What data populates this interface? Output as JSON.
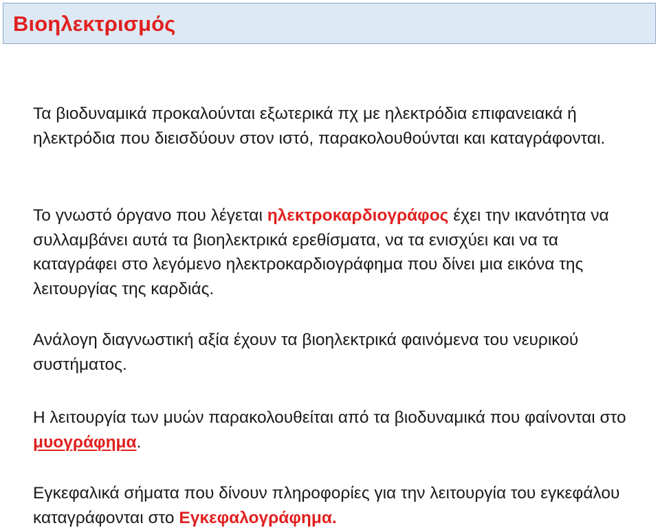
{
  "title": "Βιοηλεκτρισμός",
  "paragraphs": {
    "p1": {
      "text": "Τα βιοδυναμικά προκαλούνται εξωτερικά πχ με ηλεκτρόδια επιφανειακά ή ηλεκτρόδια που διεισδύουν στον ιστό, παρακολουθούνται και καταγράφονται."
    },
    "p2": {
      "before": "Το γνωστό όργανο που λέγεται ",
      "highlight": "ηλεκτροκαρδιογράφος",
      "after": " έχει την ικανότητα να συλλαμβάνει αυτά τα βιοηλεκτρικά ερεθίσματα, να τα ενισχύει και να τα καταγράφει στο λεγόμενο ηλεκτροκαρδιογράφημα που δίνει μια εικόνα της λειτουργίας της καρδιάς."
    },
    "p3": {
      "text": "Ανάλογη διαγνωστική αξία έχουν τα βιοηλεκτρικά φαινόμενα του νευρικού συστήματος."
    },
    "p4": {
      "before": "Η λειτουργία των μυών παρακολουθείται από τα βιοδυναμικά που φαίνονται στο  ",
      "highlight": "μυογράφημα",
      "after": "."
    },
    "p5": {
      "before": "Εγκεφαλικά σήματα που δίνουν πληροφορίες για την λειτουργία του εγκεφάλου καταγράφονται στο ",
      "highlight": "Εγκεφαλογράφημα."
    }
  },
  "colors": {
    "title_text": "#e0201f",
    "title_background": "#dde9f4",
    "title_border": "#8da8c6",
    "highlight": "#e0201f",
    "body_text": "#1a1a1a"
  }
}
